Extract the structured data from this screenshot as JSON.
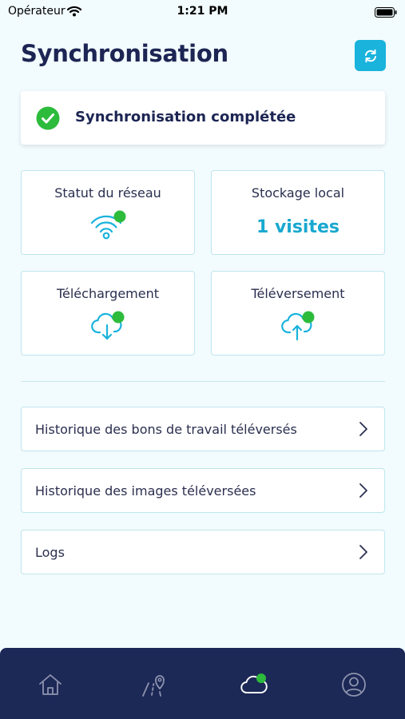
{
  "status_bar": {
    "carrier": "Opérateur",
    "time": "1:21 PM"
  },
  "header": {
    "title": "Synchronisation"
  },
  "sync_status": {
    "message": "Synchronisation complétée"
  },
  "tiles": {
    "network": {
      "label": "Statut du réseau"
    },
    "storage": {
      "label": "Stockage local",
      "value": "1 visites"
    },
    "download": {
      "label": "Téléchargement"
    },
    "upload": {
      "label": "Téléversement"
    }
  },
  "history": {
    "work_orders": "Historique des bons de travail téléversés",
    "images": "Historique des images téléversées",
    "logs": "Logs"
  },
  "nav": {
    "active_tab": "sync"
  },
  "colors": {
    "accent": "#19b3dc",
    "success": "#2dbb3c",
    "navy": "#1c2856",
    "background": "#f2fbfd"
  }
}
